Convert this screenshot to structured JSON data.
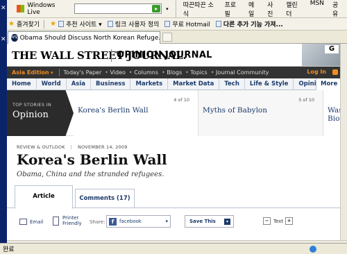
{
  "browser": {
    "toolbar": {
      "brand": "Windows Live",
      "search_value": "",
      "links": [
        "따끈따끈 소식",
        "프로필",
        "메일",
        "사진",
        "캘린더",
        "MSN",
        "공유"
      ]
    },
    "favorites": {
      "label": "즐겨찾기",
      "items": [
        "추천 사이트 ▾",
        "링크 사용자 정의",
        "무료 Hotmail",
        "다른 추가 기능 가져..."
      ]
    },
    "tab_title": "Obama Should Discuss North Korean Refuge...",
    "status_text": "완료",
    "zoom": "",
    "icons": [
      "close-icon",
      "star-icon",
      "favicon",
      "globe-icon"
    ]
  },
  "site": {
    "masthead": "THE WALL STREET JOURNAL.",
    "section_title": "OPINION JOURNAL",
    "edition": "Asia Edition",
    "topnav": [
      "Today's Paper",
      "Video",
      "Columns",
      "Blogs",
      "Topics",
      "Journal Community"
    ],
    "login": "Log In",
    "mainnav": [
      "Home",
      "World",
      "Asia",
      "Business",
      "Markets",
      "Market Data",
      "Tech",
      "Life & Style",
      "Opinion"
    ],
    "more": "More",
    "top_stories": {
      "label_small": "TOP STORIES IN",
      "label_big": "Opinion",
      "items": [
        {
          "count": "4 of 10",
          "title": "Korea's Berlin Wall"
        },
        {
          "count": "5 of 10",
          "title": "Myths of Babylon"
        },
        {
          "count": "",
          "title": "Washin Biotech"
        }
      ]
    }
  },
  "article": {
    "section": "REVIEW & OUTLOOK",
    "date": "NOVEMBER 14, 2009",
    "headline": "Korea's Berlin Wall",
    "dek": "Obama, China and the stranded refugees.",
    "tabs": [
      "Article",
      "Comments (17)"
    ],
    "tools": {
      "email": "Email",
      "print": "Printer Friendly",
      "share": "Share:",
      "facebook": "facebook",
      "save": "Save This",
      "text": "Text"
    }
  }
}
